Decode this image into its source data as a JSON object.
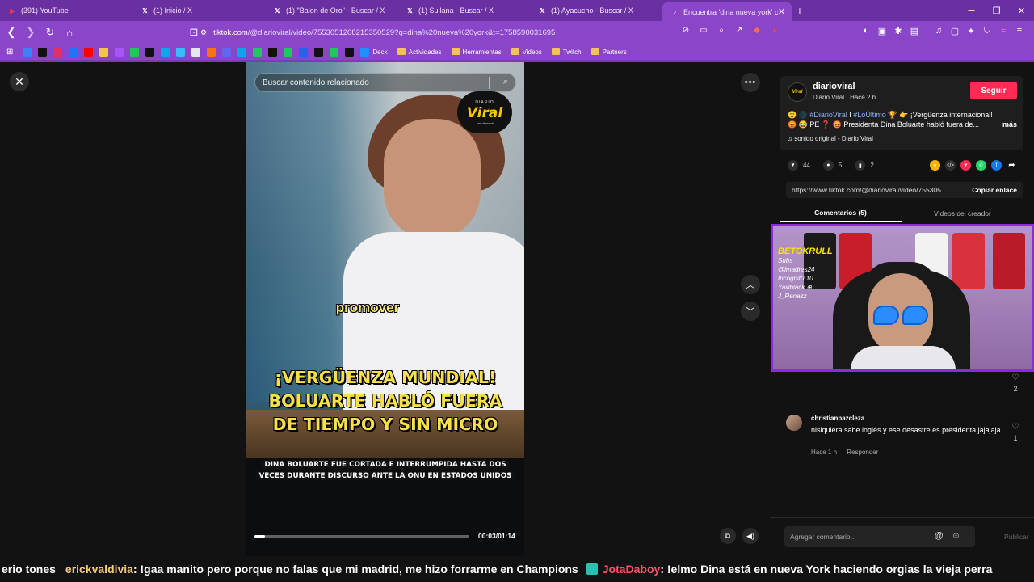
{
  "browser": {
    "tabs": [
      {
        "label": "(391) YouTube",
        "icon": "youtube-icon",
        "color": "#ff3344",
        "glyph": "▶"
      },
      {
        "label": "(1) Inicio / X",
        "icon": "x-icon",
        "color": "#ffffff",
        "glyph": "𝕏"
      },
      {
        "label": "(1) \"Balon de Oro\" - Buscar / X",
        "icon": "x-icon",
        "color": "#ffffff",
        "glyph": "𝕏"
      },
      {
        "label": "(1) Sullana - Buscar / X",
        "icon": "x-icon",
        "color": "#ffffff",
        "glyph": "𝕏"
      },
      {
        "label": "(1) Ayacucho - Buscar / X",
        "icon": "x-icon",
        "color": "#ffffff",
        "glyph": "𝕏"
      },
      {
        "label": "Encuentra 'dina nueva york' c",
        "icon": "tiktok-icon",
        "color": "#ffffff",
        "glyph": "♪",
        "active": true
      }
    ],
    "url_host": "tiktok.com",
    "url_path": "/@diarioviral/video/7553051208215350529?q=dina%20nueva%20york&t=1758590031695",
    "bookmarks": [
      {
        "label": "Deck"
      },
      {
        "label": "Actividades",
        "folder": true
      },
      {
        "label": "Herramientas",
        "folder": true
      },
      {
        "label": "Videos",
        "folder": true
      },
      {
        "label": "Twitch",
        "folder": true
      },
      {
        "label": "Partners",
        "folder": true
      }
    ],
    "bookmark_icon_colors": [
      "#3b82f6",
      "#111111",
      "#e1306c",
      "#1877f2",
      "#ff0000",
      "#f4c350",
      "#a855f7",
      "#22c55e",
      "#111111",
      "#0ea5e9",
      "#38bdf8",
      "#e5e7eb",
      "#f97316",
      "#6366f1",
      "#0ea5e9",
      "#22c55e",
      "#111111",
      "#22c55e",
      "#2563eb",
      "#111111",
      "#22c55e",
      "#111111",
      "#1e90ff"
    ]
  },
  "video": {
    "search_placeholder": "Buscar contenido relacionado",
    "logo_top": "DIARIO",
    "logo_main": "Viral",
    "logo_sub": "...es diferente",
    "caption_word": "promover",
    "headline_lines": [
      "¡VERGÜENZA MUNDIAL!",
      "BOLUARTE HABLÓ FUERA",
      "DE TIEMPO Y SIN MICRO"
    ],
    "subtitle_lines": [
      "DINA BOLUARTE FUE CORTADA E INTERRUMPIDA HASTA DOS",
      "VECES DURANTE DISCURSO ANTE LA ONU EN ESTADOS UNIDOS"
    ],
    "time": "00:03/01:14",
    "progress": 0.05
  },
  "post": {
    "username": "diarioviral",
    "meta": "Diario Viral · Hace 2 h",
    "follow_label": "Seguir",
    "desc_prefix": "😮 🌑 ",
    "tag1": "#DiarioViral",
    "desc_sep": " I ",
    "tag2": "#LoÚltimo",
    "desc_line1_rest": " 🏆 👉 ¡Vergüenza internacional!",
    "desc_line2": "😡 😂 PE ❓ 😡 Presidenta Dina Boluarte habló fuera de...",
    "more_label": "más",
    "sound": "♫  sonido original - Diario Viral",
    "likes": "44",
    "comments": "5",
    "saves": "2",
    "share_link": "https://www.tiktok.com/@diarioviral/video/755305...",
    "copy_label": "Copiar enlace",
    "tab_comments": "Comentarios (5)",
    "tab_creator": "Videos del creador"
  },
  "webcam": {
    "overlay_title": "BETOKRULL",
    "overlay_lines": [
      "Subs",
      "@lmadres24",
      "Incognit0.10",
      "Yaiilblack ⊕",
      "J_Renazz"
    ]
  },
  "comments_list": {
    "first_count": "2",
    "item": {
      "user": "christianpazcleza",
      "text": "nisiquiera sabe inglés y ese desastre es presidenta jajajaja",
      "time": "Hace 1 h",
      "reply": "Responder",
      "likes": "1"
    }
  },
  "add_comment": {
    "placeholder": "Agregar comentario...",
    "publish": "Publicar"
  },
  "chat": {
    "prev_tail": "erio tones",
    "user1": "erickvaldivia",
    "msg1": ": !gaa manito pero porque no falas que mi madrid, me hizo forrarme en Champions",
    "user2": "JotaDaboy",
    "msg2": ": !elmo Dina está en nueva York haciendo orgias la vieja perra"
  }
}
